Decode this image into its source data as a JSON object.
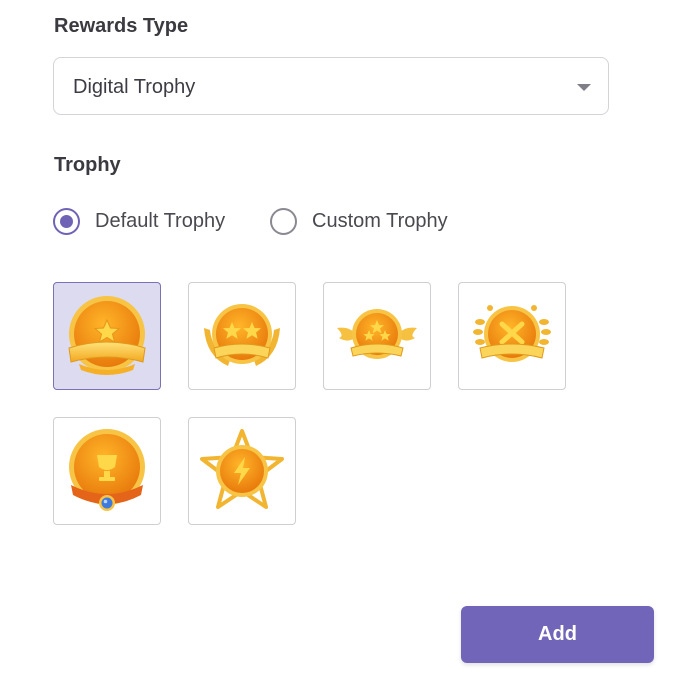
{
  "rewards_type": {
    "label": "Rewards Type",
    "selected": "Digital Trophy"
  },
  "trophy": {
    "label": "Trophy",
    "options": [
      {
        "label": "Default Trophy",
        "checked": true
      },
      {
        "label": "Custom Trophy",
        "checked": false
      }
    ],
    "tiles": [
      {
        "icon": "trophy-medal-star-ribbon-icon",
        "selected": true
      },
      {
        "icon": "trophy-two-stars-laurel-icon",
        "selected": false
      },
      {
        "icon": "trophy-winged-stars-icon",
        "selected": false
      },
      {
        "icon": "trophy-laurel-crossed-icon",
        "selected": false
      },
      {
        "icon": "trophy-cup-gem-icon",
        "selected": false
      },
      {
        "icon": "trophy-lightning-star-icon",
        "selected": false
      }
    ]
  },
  "actions": {
    "add_label": "Add"
  },
  "colors": {
    "accent": "#7165b9",
    "selected_tile": "#dddbef",
    "gold": "#f5a623",
    "orange": "#f08a12"
  }
}
